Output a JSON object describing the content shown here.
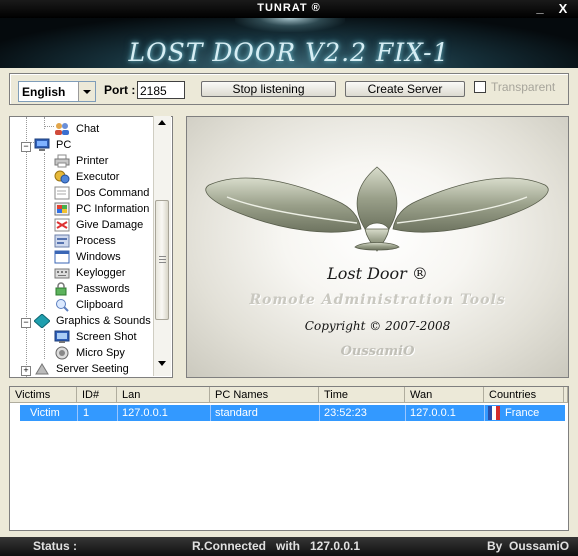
{
  "window": {
    "title": "TUNRAT ®",
    "minimize": "_",
    "close": "X"
  },
  "banner": {
    "title": "LOST DOOR V2.2 FIX-1"
  },
  "toolbar": {
    "language": "English",
    "port_label": "Port :",
    "port_value": "2185",
    "stop_label": "Stop listening",
    "create_label": "Create Server",
    "transparent_label": "Transparent"
  },
  "tree": {
    "items": [
      {
        "label": "Chat",
        "icon": "chat-icon"
      },
      {
        "label": "PC",
        "icon": "pc-icon"
      },
      {
        "label": "Printer",
        "icon": "printer-icon"
      },
      {
        "label": "Executor",
        "icon": "executor-icon"
      },
      {
        "label": "Dos Command",
        "icon": "dos-command-icon"
      },
      {
        "label": "PC Information",
        "icon": "pc-information-icon"
      },
      {
        "label": "Give Damage",
        "icon": "give-damage-icon"
      },
      {
        "label": "Process",
        "icon": "process-icon"
      },
      {
        "label": "Windows",
        "icon": "windows-icon"
      },
      {
        "label": "Keylogger",
        "icon": "keylogger-icon"
      },
      {
        "label": "Passwords",
        "icon": "passwords-icon"
      },
      {
        "label": "Clipboard",
        "icon": "clipboard-icon"
      },
      {
        "label": "Graphics & Sounds",
        "icon": "graphics-sounds-icon"
      },
      {
        "label": "Screen Shot",
        "icon": "screen-shot-icon"
      },
      {
        "label": "Micro Spy",
        "icon": "micro-spy-icon"
      },
      {
        "label": "Server Seeting",
        "icon": "server-setting-icon"
      }
    ]
  },
  "logo": {
    "title": "Lost Door ®",
    "subtitle": "Romote Administration Tools",
    "copyright": "Copyright © 2007-2008",
    "author": "OussamiO"
  },
  "grid": {
    "headers": [
      "Victims",
      "ID#",
      "Lan",
      "PC Names",
      "Time",
      "Wan",
      "Countries"
    ],
    "rows": [
      {
        "victim": "Victim",
        "id": "1",
        "lan": "127.0.0.1",
        "pc_name": "standard",
        "time": "23:52:23",
        "wan": "127.0.0.1",
        "country": "France"
      }
    ]
  },
  "status": {
    "label": "Status :",
    "message": "R.Connected   with   127.0.0.1",
    "credit": "By  OussamiO"
  },
  "colors": {
    "selection": "#3399ff",
    "form_bg": "#ece9d8",
    "banner_glow": "#6fb7c8"
  }
}
